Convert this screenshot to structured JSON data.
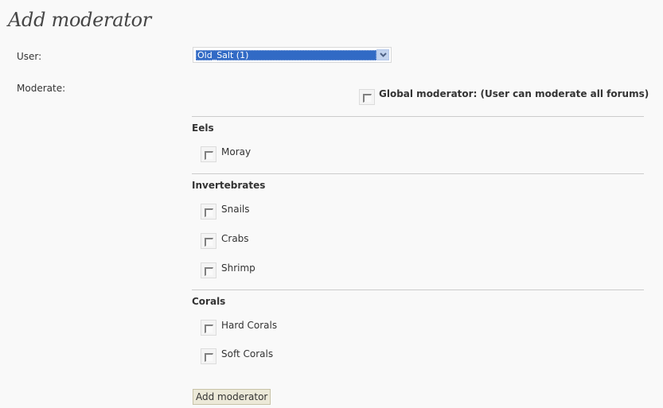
{
  "page": {
    "title": "Add moderator"
  },
  "form": {
    "user_label": "User:",
    "user_select": {
      "selected": "Old_Salt (1)",
      "icon": "chevron-down-icon"
    },
    "moderate_label": "Moderate:",
    "global_moderator": {
      "label": "Global moderator: (User can moderate all forums)",
      "checked": false
    },
    "groups": [
      {
        "title": "Eels",
        "forums": [
          {
            "label": "Moray",
            "checked": false
          }
        ]
      },
      {
        "title": "Invertebrates",
        "forums": [
          {
            "label": "Snails",
            "checked": false
          },
          {
            "label": "Crabs",
            "checked": false
          },
          {
            "label": "Shrimp",
            "checked": false
          }
        ]
      },
      {
        "title": "Corals",
        "forums": [
          {
            "label": "Hard Corals",
            "checked": false
          },
          {
            "label": "Soft Corals",
            "checked": false
          }
        ]
      }
    ],
    "submit_label": "Add moderator"
  }
}
